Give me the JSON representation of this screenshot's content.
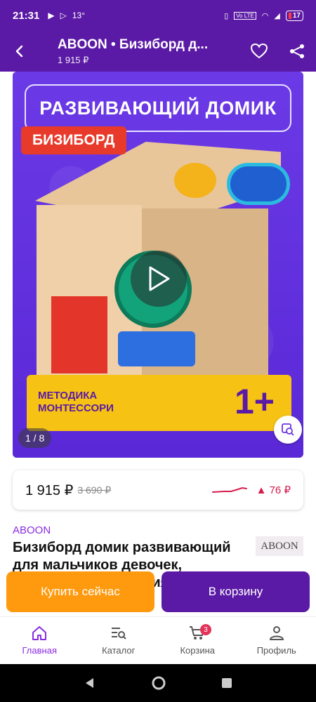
{
  "status_bar": {
    "time": "21:31",
    "temperature": "13°",
    "battery": "17"
  },
  "app_bar": {
    "title": "ABOON • Бизиборд д...",
    "subtitle": "1 915 ₽"
  },
  "hero": {
    "headline": "РАЗВИВАЮЩИЙ ДОМИК",
    "tag": "БИЗИБОРД",
    "method_line1": "МЕТОДИКА",
    "method_line2": "МОНТЕССОРИ",
    "age": "1+",
    "page_counter": "1 / 8"
  },
  "price": {
    "current": "1 915 ₽",
    "old": "3 690 ₽",
    "delta": "▲ 76 ₽"
  },
  "product": {
    "seller": "ABOON",
    "seller_logo": "ABOON",
    "title": "Бизиборд домик развивающий для мальчиков девочек, подарок для развития моторики"
  },
  "actions": {
    "buy_now": "Купить сейчас",
    "add_to_cart": "В корзину"
  },
  "bottom_nav": {
    "items": [
      {
        "label": "Главная",
        "icon": "home-icon"
      },
      {
        "label": "Каталог",
        "icon": "catalog-icon"
      },
      {
        "label": "Корзина",
        "icon": "cart-icon",
        "badge": "3"
      },
      {
        "label": "Профиль",
        "icon": "profile-icon"
      }
    ]
  },
  "colors": {
    "brand": "#5b1aa5",
    "accent_orange": "#ff9a0f",
    "active_nav": "#8a2be2",
    "price_delta": "#d61a4b"
  }
}
